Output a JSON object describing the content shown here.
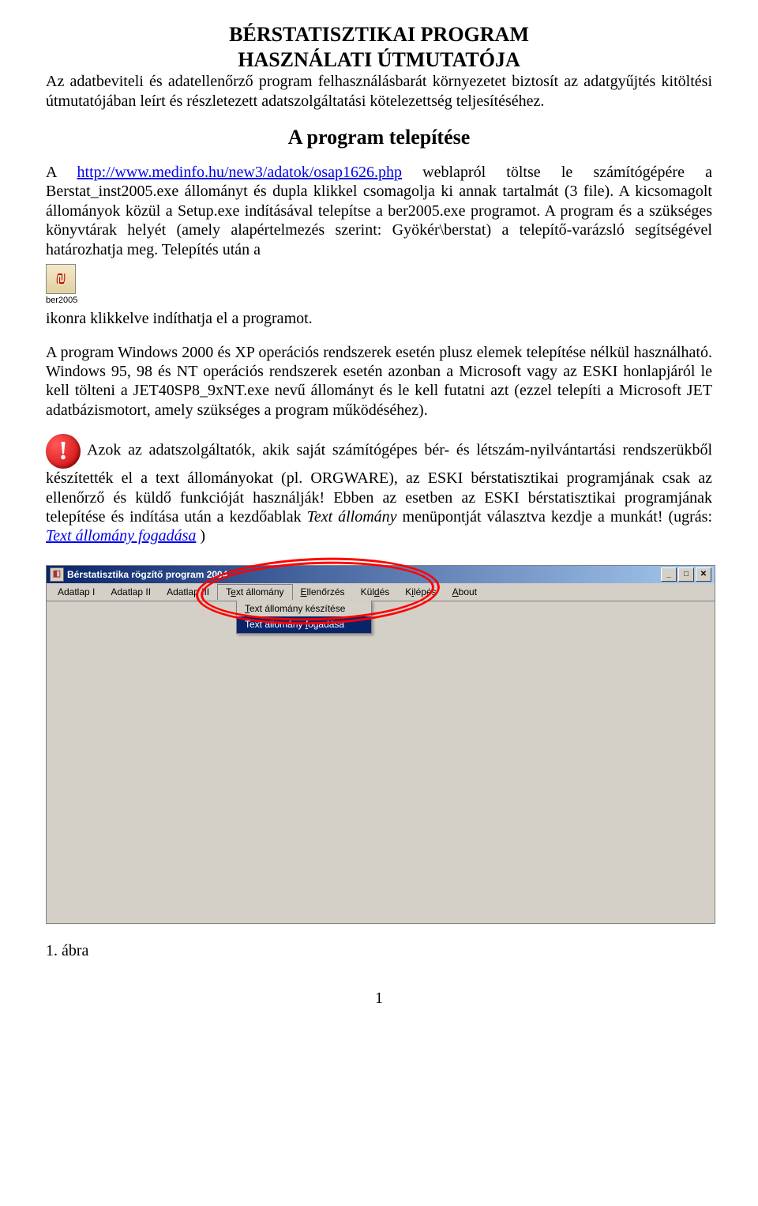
{
  "heading": {
    "title": "BÉRSTATISZTIKAI PROGRAM",
    "subtitle": "HASZNÁLATI ÚTMUTATÓJA"
  },
  "intro": "Az adatbeviteli és adatellenőrző program felhasználásbarát környezetet biztosít az adatgyűjtés kitöltési útmutatójában leírt és részletezett adatszolgáltatási kötelezettség teljesítéséhez.",
  "section_install": "A program telepítése",
  "install": {
    "p1a": "A ",
    "link1": "http://www.medinfo.hu/new3/adatok/osap1626.php",
    "p1b": " weblapról töltse le számítógépére a Berstat_inst2005.exe állományt és dupla klikkel csomagolja ki annak tartalmát (3 file). A kicsomagolt állományok közül a Setup.exe indításával telepítse a ber2005.exe programot. A program és a szükséges könyvtárak helyét (amely alapértelmezés szerint: Gyökér\\berstat) a telepítő-varázsló segítségével határozhatja meg. Telepítés után a"
  },
  "desktop_icon": {
    "glyph": "₪",
    "label": "ber2005"
  },
  "p_after_icon": "ikonra klikkelve indíthatja el a programot.",
  "p_os": "A program Windows 2000 és XP operációs rendszerek esetén plusz elemek telepítése nélkül használható. Windows 95, 98 és NT operációs rendszerek esetén azonban a Microsoft vagy az ESKI honlapjáról le kell tölteni a JET40SP8_9xNT.exe nevű állományt és le kell futatni azt (ezzel telepíti a Microsoft JET adatbázismotort, amely szükséges a program működéséhez).",
  "warn": {
    "a": "Azok az adatszolgáltatók, akik saját számítógépes bér- és létszám-nyilvántartási rendszerükből készítették el a text állományokat (pl. ORGWARE), az ESKI bérstatisztikai programjának csak az ellenőrző és küldő funkcióját használják! Ebben az esetben az ESKI bérstatisztikai programjának telepítése és indítása után a kezdőablak ",
    "italic": "Text állomány",
    "b": " menüpontját választva kezdje a munkát! (ugrás: ",
    "link": "Text állomány fogadása",
    "c": " )"
  },
  "window": {
    "title": "Bérstatisztika rögzítő program 2004",
    "menus": {
      "m1": "Adatlap I",
      "m2": "Adatlap II",
      "m3": "Adatlap III",
      "m4_pre": "T",
      "m4_u": "e",
      "m4_post": "xt állomány",
      "m5_u": "E",
      "m5_post": "llenőrzés",
      "m6_pre": "Kül",
      "m6_u": "d",
      "m6_post": "és",
      "m7_pre": "K",
      "m7_u": "i",
      "m7_post": "lépés",
      "m8_u": "A",
      "m8_post": "bout"
    },
    "dropdown": {
      "d1_u": "T",
      "d1_post": "ext állomány készítése",
      "d2_pre": "Text állomány ",
      "d2_u": "f",
      "d2_post": "ogadása"
    },
    "btn": {
      "min": "_",
      "max": "□",
      "close": "✕"
    }
  },
  "caption": "1. ábra",
  "page": "1"
}
